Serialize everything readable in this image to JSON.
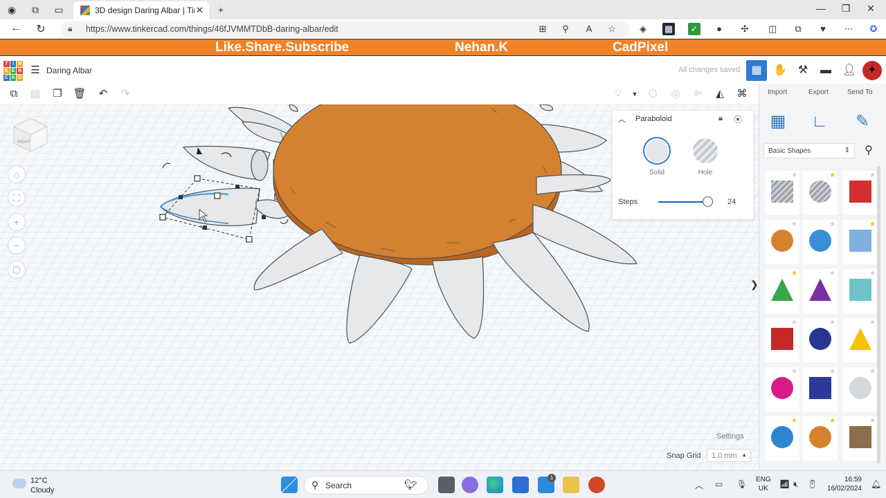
{
  "browser": {
    "tab_title": "3D design Daring Albar | Tinkercad",
    "url": "https://www.tinkercad.com/things/46fJVMMTDbB-daring-albar/edit",
    "window_buttons": [
      "—",
      "❐",
      "✕"
    ]
  },
  "banner": {
    "left": "Like.Share.Subscribe",
    "center": "Nehan.K",
    "right": "CadPixel",
    "color": "#f0822a"
  },
  "tinkercad": {
    "logo_letters": [
      "T",
      "I",
      "N",
      "K",
      "E",
      "R",
      "C",
      "A",
      "D"
    ],
    "project_name": "Daring Albar",
    "save_status": "All changes saved"
  },
  "inspector": {
    "shape_name": "Paraboloid",
    "solid_label": "Solid",
    "hole_label": "Hole",
    "steps_label": "Steps",
    "steps_value": "24"
  },
  "workplane": {
    "view_cube_label": "RIGHT",
    "settings_label": "Settings",
    "snap_label": "Snap Grid",
    "snap_value": "1.0 mm",
    "body_color": "#d4822f",
    "petal_color": "#e6e8ea"
  },
  "library": {
    "tabs": [
      "Import",
      "Export",
      "Send To"
    ],
    "category": "Basic Shapes",
    "shapes": [
      {
        "name": "box-hole",
        "color": "#aeb5bd",
        "starred": false
      },
      {
        "name": "cylinder-hole",
        "color": "#aeb5bd",
        "starred": true
      },
      {
        "name": "box",
        "color": "#d32f2f",
        "starred": false
      },
      {
        "name": "cylinder",
        "color": "#d4822f",
        "starred": false
      },
      {
        "name": "sphere",
        "color": "#3a8fd6",
        "starred": false
      },
      {
        "name": "scribble",
        "color": "#7fb0e0",
        "starred": true
      },
      {
        "name": "roof",
        "color": "#3aa64a",
        "starred": true
      },
      {
        "name": "cone",
        "color": "#7b2fa3",
        "starred": false
      },
      {
        "name": "round-roof",
        "color": "#6fc3c8",
        "starred": false
      },
      {
        "name": "text",
        "color": "#c62828",
        "starred": false
      },
      {
        "name": "half-sphere",
        "color": "#283593",
        "starred": false
      },
      {
        "name": "pyramid",
        "color": "#f4c20d",
        "starred": false
      },
      {
        "name": "hemisphere",
        "color": "#d81b8a",
        "starred": false
      },
      {
        "name": "polygon",
        "color": "#2c3a9c",
        "starred": false
      },
      {
        "name": "paraboloid",
        "color": "#d5d8dc",
        "starred": false
      },
      {
        "name": "torus",
        "color": "#2e86d0",
        "starred": true
      },
      {
        "name": "tube",
        "color": "#d4822f",
        "starred": true
      },
      {
        "name": "paperclip",
        "color": "#8d6e4a",
        "starred": false
      }
    ]
  },
  "taskbar": {
    "temperature": "12°C",
    "weather": "Cloudy",
    "search_label": "Search",
    "lang_1": "ENG",
    "lang_2": "UK",
    "time": "16:59",
    "date": "16/02/2024",
    "mail_badge": "1"
  }
}
